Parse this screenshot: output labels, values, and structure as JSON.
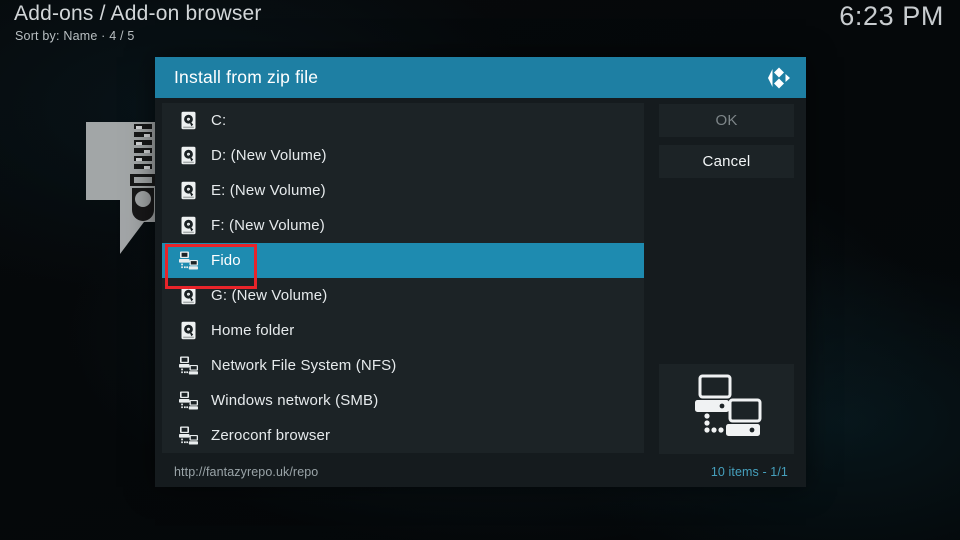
{
  "topbar": {
    "breadcrumb": "Add-ons / Add-on browser",
    "sort_line": "Sort by: Name  ·  4 / 5",
    "clock": "6:23 PM"
  },
  "dialog": {
    "title": "Install from zip file",
    "logo_icon": "kodi-logo-icon",
    "buttons": {
      "ok": "OK",
      "cancel": "Cancel"
    },
    "preview_icon": "network-computers-icon",
    "footer": {
      "path": "http://fantazyrepo.uk/repo",
      "count": "10 items - 1/1"
    },
    "items": [
      {
        "label": "C:",
        "icon": "hard-drive-icon",
        "selected": false
      },
      {
        "label": "D: (New Volume)",
        "icon": "hard-drive-icon",
        "selected": false
      },
      {
        "label": "E: (New Volume)",
        "icon": "hard-drive-icon",
        "selected": false
      },
      {
        "label": "F: (New Volume)",
        "icon": "hard-drive-icon",
        "selected": false
      },
      {
        "label": "Fido",
        "icon": "network-icon",
        "selected": true
      },
      {
        "label": "G: (New Volume)",
        "icon": "hard-drive-icon",
        "selected": false
      },
      {
        "label": "Home folder",
        "icon": "hard-drive-icon",
        "selected": false
      },
      {
        "label": "Network File System (NFS)",
        "icon": "network-icon",
        "selected": false
      },
      {
        "label": "Windows network (SMB)",
        "icon": "network-icon",
        "selected": false
      },
      {
        "label": "Zeroconf browser",
        "icon": "network-icon",
        "selected": false
      }
    ]
  },
  "background": {
    "artwork_icon": "zip-file-icon"
  },
  "colors": {
    "accent_teal": "#1e8bb0",
    "title_bar": "#1e7fa3",
    "panel": "#1c2326",
    "dialog_bg": "#151b1e",
    "annotation_red": "#e8242a",
    "footer_count": "#45a0bd"
  },
  "annotation": {
    "shape": "red-rectangle-highlight",
    "targets": "Fido"
  }
}
